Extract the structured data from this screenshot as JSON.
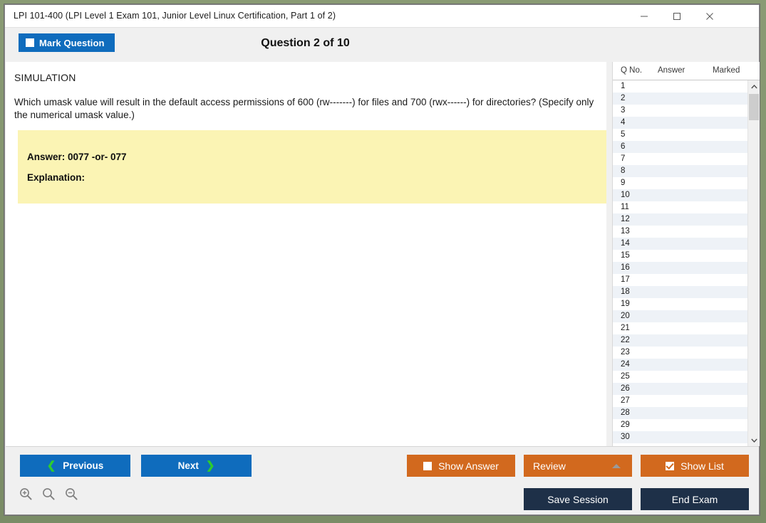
{
  "window": {
    "title": "LPI 101-400 (LPI Level 1 Exam 101, Junior Level Linux Certification, Part 1 of 2)",
    "controls": {
      "minimize": "minimize-icon",
      "maximize": "maximize-icon",
      "close": "close-icon"
    }
  },
  "header": {
    "mark_question_label": "Mark Question",
    "mark_question_checked": false,
    "question_counter": "Question 2 of 10"
  },
  "question": {
    "type_label": "SIMULATION",
    "text": "Which umask value will result in the default access permissions of 600 (rw-------) for files and 700 (rwx------) for directories? (Specify only the numerical umask value.)",
    "answer_label": "Answer: 0077 -or- 077",
    "explanation_label": "Explanation:",
    "answer_box_color": "#fbf4b4"
  },
  "list_panel": {
    "headers": [
      "Q No.",
      "Answer",
      "Marked"
    ],
    "rows": [
      {
        "no": "1",
        "answer": "",
        "marked": ""
      },
      {
        "no": "2",
        "answer": "",
        "marked": ""
      },
      {
        "no": "3",
        "answer": "",
        "marked": ""
      },
      {
        "no": "4",
        "answer": "",
        "marked": ""
      },
      {
        "no": "5",
        "answer": "",
        "marked": ""
      },
      {
        "no": "6",
        "answer": "",
        "marked": ""
      },
      {
        "no": "7",
        "answer": "",
        "marked": ""
      },
      {
        "no": "8",
        "answer": "",
        "marked": ""
      },
      {
        "no": "9",
        "answer": "",
        "marked": ""
      },
      {
        "no": "10",
        "answer": "",
        "marked": ""
      },
      {
        "no": "11",
        "answer": "",
        "marked": ""
      },
      {
        "no": "12",
        "answer": "",
        "marked": ""
      },
      {
        "no": "13",
        "answer": "",
        "marked": ""
      },
      {
        "no": "14",
        "answer": "",
        "marked": ""
      },
      {
        "no": "15",
        "answer": "",
        "marked": ""
      },
      {
        "no": "16",
        "answer": "",
        "marked": ""
      },
      {
        "no": "17",
        "answer": "",
        "marked": ""
      },
      {
        "no": "18",
        "answer": "",
        "marked": ""
      },
      {
        "no": "19",
        "answer": "",
        "marked": ""
      },
      {
        "no": "20",
        "answer": "",
        "marked": ""
      },
      {
        "no": "21",
        "answer": "",
        "marked": ""
      },
      {
        "no": "22",
        "answer": "",
        "marked": ""
      },
      {
        "no": "23",
        "answer": "",
        "marked": ""
      },
      {
        "no": "24",
        "answer": "",
        "marked": ""
      },
      {
        "no": "25",
        "answer": "",
        "marked": ""
      },
      {
        "no": "26",
        "answer": "",
        "marked": ""
      },
      {
        "no": "27",
        "answer": "",
        "marked": ""
      },
      {
        "no": "28",
        "answer": "",
        "marked": ""
      },
      {
        "no": "29",
        "answer": "",
        "marked": ""
      },
      {
        "no": "30",
        "answer": "",
        "marked": ""
      }
    ],
    "scrollbar": {
      "up_arrow_icon": "chevron-up-icon",
      "down_arrow_icon": "chevron-down-icon"
    }
  },
  "toolbar": {
    "previous_label": "Previous",
    "next_label": "Next",
    "show_answer_label": "Show Answer",
    "show_answer_checked": false,
    "review_label": "Review",
    "show_list_label": "Show List",
    "show_list_checked": true,
    "save_session_label": "Save Session",
    "end_exam_label": "End Exam",
    "zoom_in_icon": "zoom-in-icon",
    "zoom_reset_icon": "zoom-icon",
    "zoom_out_icon": "zoom-out-icon"
  },
  "colors": {
    "primary_blue": "#0f6cbd",
    "accent_orange": "#d2691e",
    "dark_navy": "#1e3048",
    "chevron_green": "#2ecc2e",
    "answer_yellow": "#fbf4b4",
    "row_alt": "#eef2f7"
  }
}
